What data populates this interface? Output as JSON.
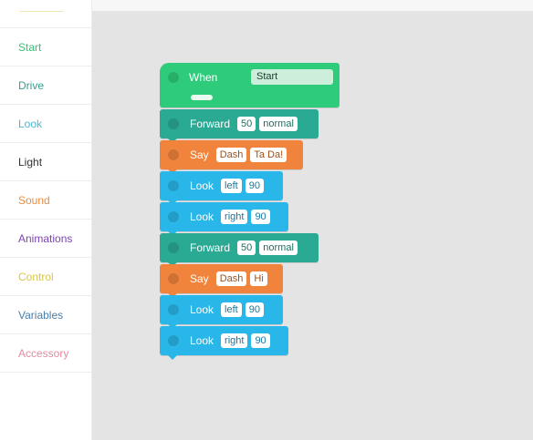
{
  "sidebar": {
    "categories": [
      {
        "label": "Start",
        "color": "#3cbf74"
      },
      {
        "label": "Drive",
        "color": "#3a9e8c"
      },
      {
        "label": "Look",
        "color": "#4fb6d6"
      },
      {
        "label": "Light",
        "color": "#333333"
      },
      {
        "label": "Sound",
        "color": "#e88e45"
      },
      {
        "label": "Animations",
        "color": "#7a44b0"
      },
      {
        "label": "Control",
        "color": "#d9c64a"
      },
      {
        "label": "Variables",
        "color": "#4a7ea8"
      },
      {
        "label": "Accessory",
        "color": "#e58ba0"
      }
    ]
  },
  "script": {
    "start_block": {
      "keyword": "When",
      "event": "Start",
      "color": "#2ecc7a"
    },
    "blocks": [
      {
        "keyword": "Forward",
        "color": "#2aaa93",
        "text_color": "#1e6f61",
        "params": [
          "50",
          "normal"
        ]
      },
      {
        "keyword": "Say",
        "color": "#f0843d",
        "text_color": "#a34f14",
        "params": [
          "Dash",
          "Ta Da!"
        ]
      },
      {
        "keyword": "Look",
        "color": "#29b6e8",
        "text_color": "#1877a0",
        "params": [
          "left",
          "90"
        ]
      },
      {
        "keyword": "Look",
        "color": "#29b6e8",
        "text_color": "#1877a0",
        "params": [
          "right",
          "90"
        ]
      },
      {
        "keyword": "Forward",
        "color": "#2aaa93",
        "text_color": "#1e6f61",
        "params": [
          "50",
          "normal"
        ]
      },
      {
        "keyword": "Say",
        "color": "#f0843d",
        "text_color": "#a34f14",
        "params": [
          "Dash",
          "Hi"
        ]
      },
      {
        "keyword": "Look",
        "color": "#29b6e8",
        "text_color": "#1877a0",
        "params": [
          "left",
          "90"
        ]
      },
      {
        "keyword": "Look",
        "color": "#29b6e8",
        "text_color": "#1877a0",
        "params": [
          "right",
          "90"
        ]
      }
    ]
  }
}
